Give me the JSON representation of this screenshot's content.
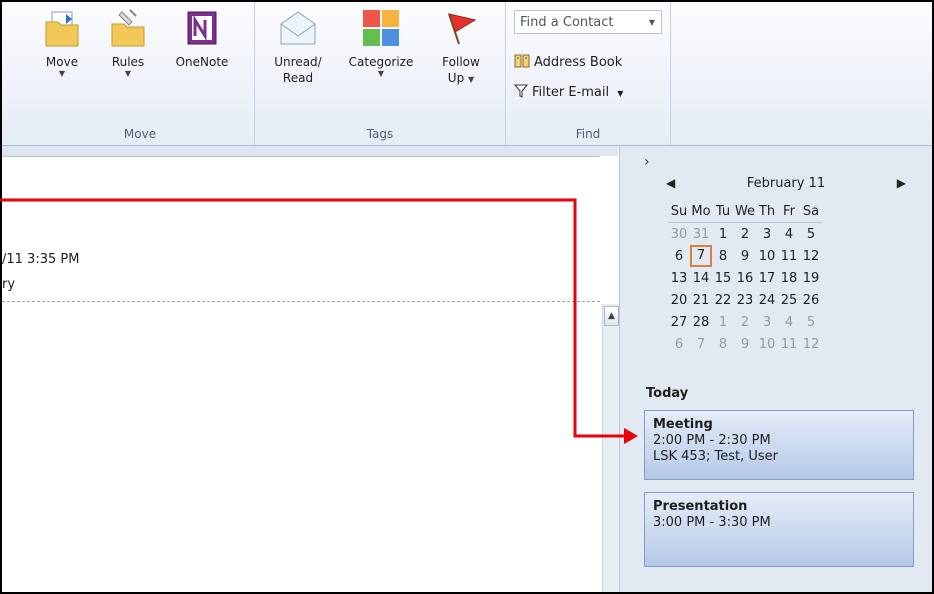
{
  "ribbon": {
    "groups": {
      "move": {
        "label": "Move",
        "buttons": {
          "move": {
            "label": "Move"
          },
          "rules": {
            "label": "Rules"
          },
          "onenote": {
            "label": "OneNote"
          }
        }
      },
      "tags": {
        "label": "Tags",
        "buttons": {
          "unread": {
            "label1": "Unread/",
            "label2": "Read"
          },
          "categorize": {
            "label": "Categorize"
          },
          "follow": {
            "label1": "Follow",
            "label2": "Up"
          }
        }
      },
      "find": {
        "label": "Find",
        "find_contact": {
          "value": "Find a Contact"
        },
        "address_book": {
          "label": "Address Book"
        },
        "filter_email": {
          "label": "Filter E-mail"
        }
      }
    }
  },
  "message": {
    "date_fragment": "/11 3:35 PM",
    "category_fragment": "ry"
  },
  "calendar": {
    "title": "February 11",
    "weekdays": [
      "Su",
      "Mo",
      "Tu",
      "We",
      "Th",
      "Fr",
      "Sa"
    ],
    "weeks": [
      [
        "30",
        "31",
        "1",
        "2",
        "3",
        "4",
        "5"
      ],
      [
        "6",
        "7",
        "8",
        "9",
        "10",
        "11",
        "12"
      ],
      [
        "13",
        "14",
        "15",
        "16",
        "17",
        "18",
        "19"
      ],
      [
        "20",
        "21",
        "22",
        "23",
        "24",
        "25",
        "26"
      ],
      [
        "27",
        "28",
        "1",
        "2",
        "3",
        "4",
        "5"
      ],
      [
        "6",
        "7",
        "8",
        "9",
        "10",
        "11",
        "12"
      ]
    ],
    "today_day": "7"
  },
  "todo": {
    "today_label": "Today",
    "appointments": [
      {
        "title": "Meeting",
        "time": "2:00 PM - 2:30 PM",
        "location": "LSK 453; Test, User"
      },
      {
        "title": "Presentation",
        "time": "3:00 PM - 3:30 PM"
      }
    ]
  },
  "colors": {
    "callout": "#e8000b",
    "today_border": "#d4823a",
    "appointment": "#b5c9e6"
  }
}
